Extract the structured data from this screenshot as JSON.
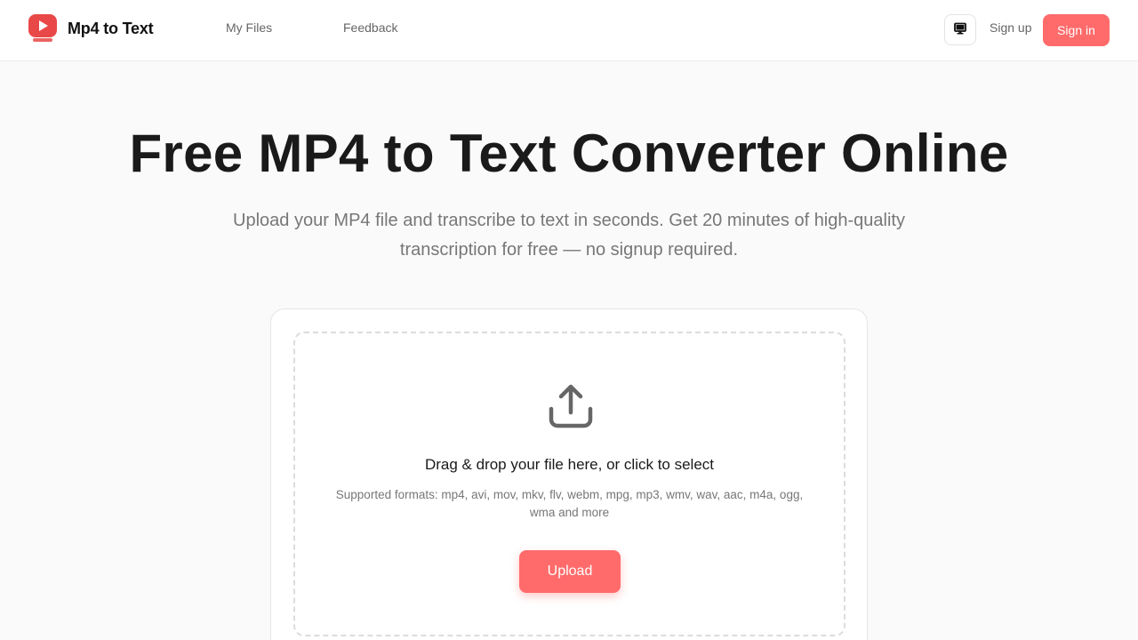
{
  "header": {
    "brand": "Mp4 to Text",
    "nav": {
      "my_files": "My Files",
      "feedback": "Feedback"
    },
    "theme_icon": "monitor-icon",
    "sign_up": "Sign up",
    "sign_in": "Sign in"
  },
  "hero": {
    "title": "Free MP4 to Text Converter Online",
    "subtitle": "Upload your MP4 file and transcribe to text in seconds. Get 20 minutes of high-quality transcription for free — no signup required."
  },
  "uploader": {
    "icon": "upload-icon",
    "title": "Drag & drop your file here, or click to select",
    "formats": "Supported formats: mp4, avi, mov, mkv, flv, webm, mpg, mp3, wmv, wav, aac, m4a, ogg, wma and more",
    "button": "Upload"
  },
  "colors": {
    "accent": "#ff6b6b",
    "logo_red": "#e94848",
    "text_dark": "#1a1a1a",
    "text_muted": "#777777",
    "border": "#e6e6e6"
  }
}
